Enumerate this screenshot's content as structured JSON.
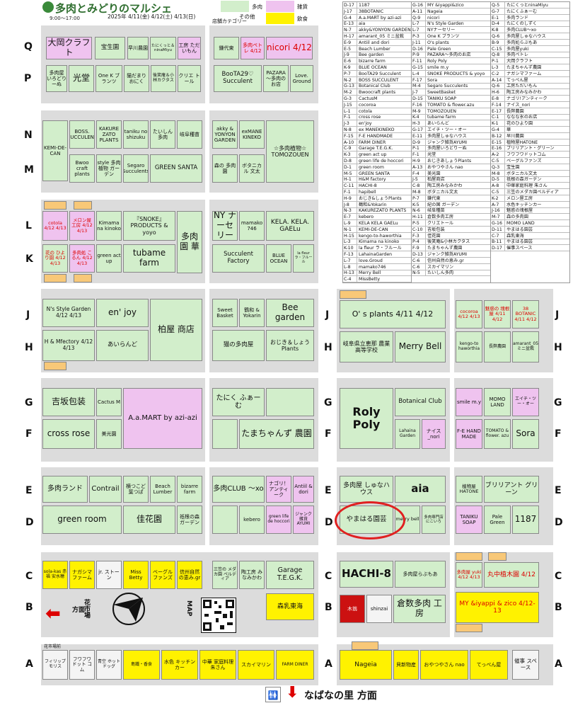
{
  "header": {
    "title": "多肉とみどりのマルシェ",
    "hours": "9:00～17:00",
    "dates": "2025年 4/11(金) 4/12(土) 4/13(日)",
    "category_title": "店舗カテゴリー",
    "legend": [
      {
        "label": "多肉",
        "color": "#d2eecb"
      },
      {
        "label": "雑貨",
        "color": "#efc3ef"
      },
      {
        "label": "その他",
        "color": "#d2eecb"
      },
      {
        "label": "飲食",
        "color": "#fff200"
      }
    ]
  },
  "rows": {
    "Q": "Q",
    "P": "P",
    "N": "N",
    "M": "M",
    "L": "L",
    "K": "K",
    "J": "J",
    "H": "H",
    "G": "G",
    "F": "F",
    "E": "E",
    "D": "D",
    "C": "C",
    "B": "B",
    "A": "A"
  },
  "booths": {
    "q_1": "大岡クラフト",
    "q_3": "宝生園",
    "q_4": "早川農園",
    "q_5": "たにくっと＆ninaMiyu",
    "q_6": "工房 ただいもん",
    "q_7": "鎌代東",
    "q_8": "多肉ペトレ 4/12",
    "q_9": "nicori 4/12",
    "p_1": "多肉屋 いろどりーぬ",
    "p_2": "光堂",
    "p_3": "One K ブランツ",
    "p_4": "猫だまり おにく",
    "p_5": "後笑庵＆小林カクタス",
    "p_6": "クリエ トール",
    "p_78": "BooTA29♡ Succulent",
    "p_9": "PAZARA～多肉の お店",
    "p_10": "Love. Ground",
    "n_1": "KEMI-DE-CAN",
    "n_2": "BOSS. SUCCULENT",
    "n_3": "KAKURE ZATO PLANTS",
    "n_4": "taniku no shizuku",
    "n_5": "たいしん 多肉",
    "n_6": "岐阜種苗",
    "n_7": "akky & YONYON GARDEN",
    "n_8": "exMANE KINEKO",
    "m_2": "Bwoo craft plants",
    "m_3": "style 多肉植物 ガーデン",
    "m_4": "Segaro Succulents",
    "m_56": "GREEN SANTA",
    "m_7": "森の 多肉園",
    "m_8": "ボタニカル 文太",
    "m_9": "☆多肉植物☆ TOMOZOUEN",
    "l_1": "cotola 4/12 4/13",
    "l_2": "メロン屋 工房 4/12 4/13",
    "l_3": "Kimama na kinoko",
    "l_45": "『SNOKE』 PRODUCTS & yoyo",
    "l_6": "多肉園 華",
    "l_7": "NY ナーセリー",
    "l_8": "mamako 746",
    "l_9": "KELA. KELA. GAELu",
    "k_1": "花の ひより園 4/12 4/13",
    "k_2": "多肉処 こるん 4/12 4/13",
    "k_3": "green act up",
    "k_45": "tubame farm",
    "k_78": "Succulent Factory",
    "k_9": "BLUE OCEAN",
    "k_10": "la fleur ラ・フルール",
    "j_1": "N's Style Garden 4/12 4/13",
    "j_3": "en' joy",
    "j_5": "柏屋 商店",
    "j_7": "Sweet Basket",
    "j_8": "鶴和 & Yokarin",
    "j_9": "Bee garden",
    "h_1": "H & Mfectory 4/12 4/13",
    "h_3": "あいらんど",
    "h_78": "猫の多肉屋",
    "h_9": "おじき＆しょう Plants",
    "g_1": "吉坂包装",
    "g_3": "Cactus M",
    "g_45": "A.a.MART by azi-azi",
    "g_78": "たにく ふぁーむ",
    "f_1": "cross rose",
    "f_3": "美光園",
    "f_9": "たまちゃんず 農園",
    "e_1": "多肉ランド",
    "e_3": "Contrail",
    "e_4": "横つこど 葉つぱ",
    "e_5": "Beach Lumber",
    "e_6": "bizarre farm",
    "e_7": "多肉CLUB ～xo",
    "e_8": "ナゴリ！アンティーク",
    "e_9": "Antiil & dori",
    "d_1": "green room",
    "d_4": "佳花園",
    "d_5": "祇根の森 ガーデン",
    "d_7": "kebero",
    "d_8": "green life de hoccori",
    "d_9": "ジャンク 雑貨 AYUMI",
    "c_1": "sola-kas 赤福 安水穂",
    "c_2": "ナガシマ ファーム",
    "c_3": "jr. ストーン",
    "c_4": "Miss Betty",
    "c_5": "ベーグル ファンズ",
    "c_6": "信州自然 の恵み.gr",
    "c_7": "三笠の メダカ園 ペルディア",
    "c_8": "陶工房 みなみかわ",
    "c_9": "Garage T.E.G.K.",
    "b_9": "森乳東海",
    "b_map": "MAP",
    "b_flower": "花市場",
    "b_dir": "方面",
    "a_header": "花市場前",
    "a_1": "フィリップ モリス",
    "a_2": "フワフワ ドット コム",
    "a_3": "青空 ホットドッグ",
    "a_6": "島鐵・香食",
    "a_7": "水色 キッチン カー",
    "a_8": "中華 家庭料理 朱さん",
    "a_9": "スカイマリン",
    "a_10": "FARM DINER",
    "r_j11": "O' s plants 4/11 4/12",
    "r_h11": "岐阜県立恵那 農業高等学校",
    "r_h13": "Merry Bell",
    "r_j15": "cocoroa 4/12 4/13",
    "r_j16": "魅惑の 塊根屋 4/11 4/12",
    "r_j17": "38 BOTANIC 4/11 4/12",
    "r_h15": "kengo-to haworthia",
    "r_h16": "長弊農園",
    "r_h17": "amarant_05 ミニ盆栽",
    "r_g11": "Roly Poly",
    "r_g13": "Botanical Club",
    "r_f13": "Lahaina Garden",
    "r_f14": "ナイス _nori",
    "r_g15": "smile m.y",
    "r_g16": "MOMO LAND",
    "r_g17": "エイチ・ツー・オー",
    "r_f15": "F-E HAND MADE",
    "r_f16": "TOMATO & flower. azu",
    "r_f17": "Sora",
    "r_e11": "多肉屋 しゅなハウス",
    "r_e13": "aia",
    "r_d11": "やまはる園芸",
    "r_d13": "merry bell",
    "r_d14": "多肉専門店 にこいろ",
    "r_e15": "植物屋 HATONE",
    "r_e16": "ブリリアント グリーン",
    "r_d15": "TANIKU SOAP",
    "r_d16": "Pale Green",
    "r_d17": "1187",
    "r_c11": "HACHI-8",
    "r_c13": "多肉屋らぶもあ",
    "r_c15": "多肉屋 yuki 4/12 4/13",
    "r_c16": "丸中植木園 4/12",
    "r_b11": "木翁",
    "r_b12": "shinzai",
    "r_b13": "倉数多肉 工房",
    "r_b15": "MY &iyappi & zico 4/12-13",
    "r_a11": "Nageia",
    "r_a12": "貝新物産",
    "r_a13": "おやつやさん nao",
    "r_a14": "てっぺん屋",
    "r_a17": "催事 スペース",
    "bottom_dir": "なばなの里 方面"
  },
  "list_left": [
    [
      "D-17",
      "1187"
    ],
    [
      "J-17",
      "38BOTANIC"
    ],
    [
      "G-4",
      "A.a.MART by azi-azi"
    ],
    [
      "E-13",
      "aia"
    ],
    [
      "N-7",
      "akky&YONYON GARDEN"
    ],
    [
      "H-17",
      "amarant_05 ミニ盆栽"
    ],
    [
      "E-9",
      "Antiil and dori"
    ],
    [
      "E-5",
      "Beach Lumber"
    ],
    [
      "J-9",
      "Bee garden"
    ],
    [
      "E-6",
      "bizarre farm"
    ],
    [
      "K-9",
      "BLUE OCEAN"
    ],
    [
      "P-7",
      "BooTA29 Succulent"
    ],
    [
      "N-2",
      "BOSS SUCCULENT"
    ],
    [
      "G-13",
      "Botanical Club"
    ],
    [
      "M-2",
      "Bwoocraft plants"
    ],
    [
      "G-3",
      "CactusM"
    ],
    [
      "J-15",
      "cocoroa"
    ],
    [
      "L-1",
      "cotola"
    ],
    [
      "F-1",
      "cross rose"
    ],
    [
      "J-3",
      "en'joy"
    ],
    [
      "N-8",
      "ex MANEKINEKO"
    ],
    [
      "F-15",
      "F-E HANDMADE"
    ],
    [
      "A-10",
      "FARM DINER"
    ],
    [
      "C-9",
      "Garage T.E.G.K."
    ],
    [
      "K-3",
      "green act up"
    ],
    [
      "D-8",
      "green life de hoccori"
    ],
    [
      "D-1",
      "green room"
    ],
    [
      "M-5",
      "GREEN SANTA"
    ],
    [
      "H-1",
      "H&M factory"
    ],
    [
      "C-11",
      "HACHI-8"
    ],
    [
      "F-1",
      "hapibell"
    ],
    [
      "H-9",
      "おじき&しょうPlants"
    ],
    [
      "J-8",
      "鶴和&Yokarin"
    ],
    [
      "N-3",
      "KAKUREZATO PLANTS"
    ],
    [
      "E-7",
      "kebero"
    ],
    [
      "L-9",
      "KELA KELA GAELu"
    ],
    [
      "N-1",
      "KEMI-DE-CAN"
    ],
    [
      "H-15",
      "kengo-to-haworthia"
    ],
    [
      "L-3",
      "Kimama na kinoko"
    ],
    [
      "K-10",
      "la fleur ラ・フルール"
    ],
    [
      "F-13",
      "LahainaGarden"
    ],
    [
      "L-7",
      "love.Groud"
    ],
    [
      "L-8",
      "mamako746"
    ],
    [
      "H-13",
      "Merry Bell"
    ],
    [
      "C-4",
      "MissBetty"
    ]
  ],
  "list_mid": [
    [
      "G-16",
      "MY &iyappi&zico"
    ],
    [
      "A-11",
      "Nageia"
    ],
    [
      "Q-9",
      "nicori"
    ],
    [
      "L-7",
      "N's Style Garden"
    ],
    [
      "L-7",
      "NYナーセリー"
    ],
    [
      "P-3",
      "One K ブランツ"
    ],
    [
      "J-11",
      "O's plants"
    ],
    [
      "D-16",
      "Pale Green"
    ],
    [
      "P-9",
      "PAZARA～多肉のお店"
    ],
    [
      "F-11",
      "Roly Poly"
    ],
    [
      "G-15",
      "smile m.y"
    ],
    [
      "L-4",
      "SNOKE PRODUCTS & yoyo"
    ],
    [
      "F-17",
      "Sora"
    ],
    [
      "M-4",
      "Segaro Succulents"
    ],
    [
      "J-7",
      "SweetBasket"
    ],
    [
      "D-15",
      "TANIKU SOAP"
    ],
    [
      "F-16",
      "TOMATO & flower.azu"
    ],
    [
      "M-9",
      "TOMOZOUEN"
    ],
    [
      "K-4",
      "tubame farm"
    ],
    [
      "H-3",
      "あいらんど"
    ],
    [
      "G-17",
      "エイチ・ツー・オー"
    ],
    [
      "E-11",
      "多肉屋しゅなハウス"
    ],
    [
      "D-9",
      "ジャンク雑貨AYUMI"
    ],
    [
      "P-1",
      "多肉屋いろどりーぬ"
    ],
    [
      "F-1",
      "光堂"
    ],
    [
      "H-9",
      "おじきあしょうPlants"
    ],
    [
      "A-13",
      "おやつやさん nao"
    ],
    [
      "F-4",
      "美光園"
    ],
    [
      "J-5",
      "柏屋商店"
    ],
    [
      "C-8",
      "陶工房みなみかわ"
    ],
    [
      "M-8",
      "ボタニカル文太"
    ],
    [
      "P-7",
      "鎌代東"
    ],
    [
      "K-5",
      "紀の国 ガーデン"
    ],
    [
      "N-6",
      "岐阜種苗"
    ],
    [
      "H-11",
      "倉数多肉工房"
    ],
    [
      "P-5",
      "クリエトール"
    ],
    [
      "C-10",
      "吉坂包装"
    ],
    [
      "F-3",
      "佳花園"
    ],
    [
      "P-4",
      "後笑庵&小林カクタス"
    ],
    [
      "F-9",
      "たまちゃんず農園"
    ],
    [
      "D-13",
      "ジャンク雑貨AYUMI"
    ],
    [
      "C-6",
      "信州自然の恵み.gr"
    ],
    [
      "C-6",
      "スカイマリン"
    ],
    [
      "N-5",
      "たいしん多肉"
    ]
  ],
  "list_right": [
    [
      "Q-5",
      "たにくっとninaMiyu"
    ],
    [
      "G-7",
      "たにくふぁーむ"
    ],
    [
      "E-1",
      "多肉ランド"
    ],
    [
      "D-4",
      "たにくのしずく"
    ],
    [
      "K-8",
      "多肉CLUB～xo"
    ],
    [
      "Q-6",
      "多肉屋しゅなハウス"
    ],
    [
      "B-9",
      "多肉処らぶもあ"
    ],
    [
      "C-15",
      "多肉屋yuki"
    ],
    [
      "Q-8",
      "多肉ペトレ"
    ],
    [
      "P-1",
      "大岡クラフト"
    ],
    [
      "L-3",
      "たまちゃんず農園"
    ],
    [
      "C-2",
      "ナガシマファーム"
    ],
    [
      "A-14",
      "てっぺん屋"
    ],
    [
      "Q-6",
      "工房ただいもん"
    ],
    [
      "H-6",
      "陶工房みなみかわ"
    ],
    [
      "E-8",
      "ナゴリ!アンティーク"
    ],
    [
      "F-14",
      "ナイス_nori"
    ],
    [
      "E-17",
      "長弊農園"
    ],
    [
      "C-1",
      "ななな氷のお店"
    ],
    [
      "K-1",
      "花のひより園"
    ],
    [
      "G-4",
      "華"
    ],
    [
      "B-12",
      "早川農園"
    ],
    [
      "E-15",
      "植物屋HATONE"
    ],
    [
      "E-16",
      "ブリリアント・グリーン"
    ],
    [
      "A-2",
      "フワフワドットコム"
    ],
    [
      "C-5",
      "ベーグルファンズ"
    ],
    [
      "Q-3",
      "宝生園"
    ],
    [
      "M-8",
      "ボタニカル文太"
    ],
    [
      "D-5",
      "祇根の森ガーデン"
    ],
    [
      "A-8",
      "中華家庭料理 朱さん"
    ],
    [
      "C-5",
      "三笠のメダカ園ペルディア"
    ],
    [
      "K-2",
      "メロン屋工房"
    ],
    [
      "A-7",
      "水色キッチンカー"
    ],
    [
      "J-16",
      "魅惑の塊根屋"
    ],
    [
      "M-7",
      "森の多肉園"
    ],
    [
      "G-16",
      "MOMO LAND"
    ],
    [
      "D-11",
      "やまはる園芸"
    ],
    [
      "C-7",
      "森乳東海"
    ],
    [
      "B-11",
      "やまはる園芸"
    ],
    [
      "D-17",
      "催事スペース"
    ]
  ],
  "colors": {
    "succulent": "#d2eecb",
    "goods": "#efc3ef",
    "food": "#fff200",
    "date": "#f8c878",
    "highlight": "#e02020"
  }
}
